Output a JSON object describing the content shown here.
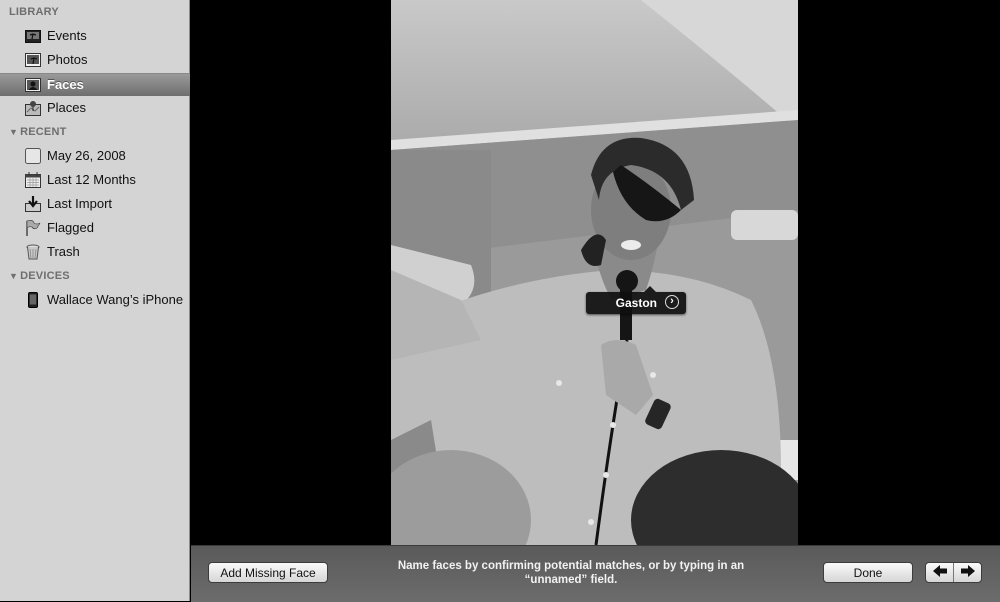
{
  "sidebar": {
    "sections": [
      {
        "title": "LIBRARY",
        "collapsible": false,
        "items": [
          {
            "label": "Events",
            "icon": "events-icon",
            "selected": false
          },
          {
            "label": "Photos",
            "icon": "photos-icon",
            "selected": false
          },
          {
            "label": "Faces",
            "icon": "faces-icon",
            "selected": true
          },
          {
            "label": "Places",
            "icon": "places-icon",
            "selected": false
          }
        ]
      },
      {
        "title": "RECENT",
        "collapsible": true,
        "expanded": true,
        "items": [
          {
            "label": "May 26, 2008",
            "icon": "event-album-icon"
          },
          {
            "label": "Last 12 Months",
            "icon": "calendar-icon"
          },
          {
            "label": "Last Import",
            "icon": "import-icon"
          },
          {
            "label": "Flagged",
            "icon": "flag-icon"
          },
          {
            "label": "Trash",
            "icon": "trash-icon"
          }
        ]
      },
      {
        "title": "DEVICES",
        "collapsible": true,
        "expanded": true,
        "items": [
          {
            "label": "Wallace Wang’s iPhone",
            "icon": "iphone-icon"
          }
        ]
      }
    ]
  },
  "viewer": {
    "face_tag": {
      "name": "Gaston",
      "icon": "chevron-right-circle-icon"
    }
  },
  "bottombar": {
    "add_missing_face_label": "Add Missing Face",
    "hint_line1": "Name faces by confirming potential matches, or by typing in an",
    "hint_line2": "“unnamed” field.",
    "done_label": "Done",
    "prev_icon": "arrow-left-icon",
    "next_icon": "arrow-right-icon"
  },
  "colors": {
    "sidebar_bg": "#d4d4d4",
    "selection": "#7a7a7a",
    "bottombar_bg": "#626262"
  }
}
